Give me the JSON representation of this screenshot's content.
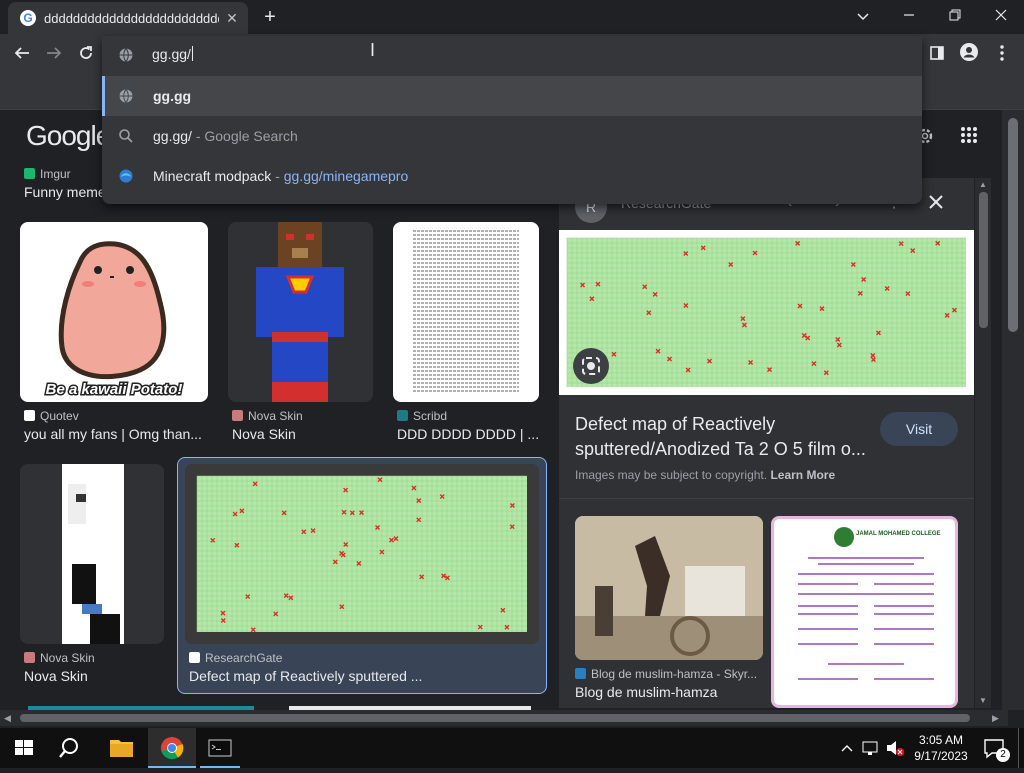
{
  "browser": {
    "tab_title": "dddddddddddddddddddddddddddddddddddd",
    "favicon_letter": "G",
    "close_tab_icon": "close-icon",
    "new_tab_icon": "plus-icon",
    "window_controls": [
      "chevron-down-icon",
      "minimize-icon",
      "restore-icon",
      "close-icon"
    ]
  },
  "omnibox": {
    "input_value": "gg.gg/",
    "suggestions": [
      {
        "kind": "url",
        "text": "gg.gg",
        "icon": "globe-icon"
      },
      {
        "kind": "search",
        "text": "gg.gg/",
        "suffix": " - Google Search",
        "icon": "search-icon"
      },
      {
        "kind": "history",
        "text": "Minecraft modpack",
        "separator": " - ",
        "link": "gg.gg/minegamepro",
        "icon": "edge-icon"
      }
    ]
  },
  "google": {
    "logo": "Google"
  },
  "results": [
    {
      "source": "Imgur",
      "caption": "Funny meme"
    },
    {
      "source": "Quotev",
      "caption": "you all my fans | Omg than...",
      "image_text": "Be a kawaii Potato!"
    },
    {
      "source": "Nova Skin",
      "caption": "Nova Skin"
    },
    {
      "source": "Scribd",
      "caption": "DDD DDDD DDDD | ..."
    },
    {
      "source": "Nova Skin",
      "caption": "Nova Skin"
    },
    {
      "source": "ResearchGate",
      "caption": "Defect map of Reactively sputtered ..."
    }
  ],
  "panel": {
    "source": "ResearchGate",
    "source_letter": "R",
    "title_line1": "Defect map of Reactively",
    "title_line2": "sputtered/Anodized Ta 2 O 5 film o...",
    "visit_label": "Visit",
    "copyright": "Images may be subject to copyright.",
    "learn_more": "Learn More",
    "related": [
      {
        "source": "Blog de muslim-hamza - Skyr...",
        "caption": "Blog de muslim-hamza"
      },
      {
        "source": "",
        "caption": "",
        "image_title": "JAMAL MOHAMED COLLEGE"
      }
    ]
  },
  "taskbar": {
    "time": "3:05 AM",
    "date": "9/17/2023",
    "notification_count": "2"
  },
  "colors": {
    "accent": "#8ab4f8",
    "bg": "#202124",
    "grid_green": "#b5e8a8",
    "defect_red": "#d93025"
  }
}
